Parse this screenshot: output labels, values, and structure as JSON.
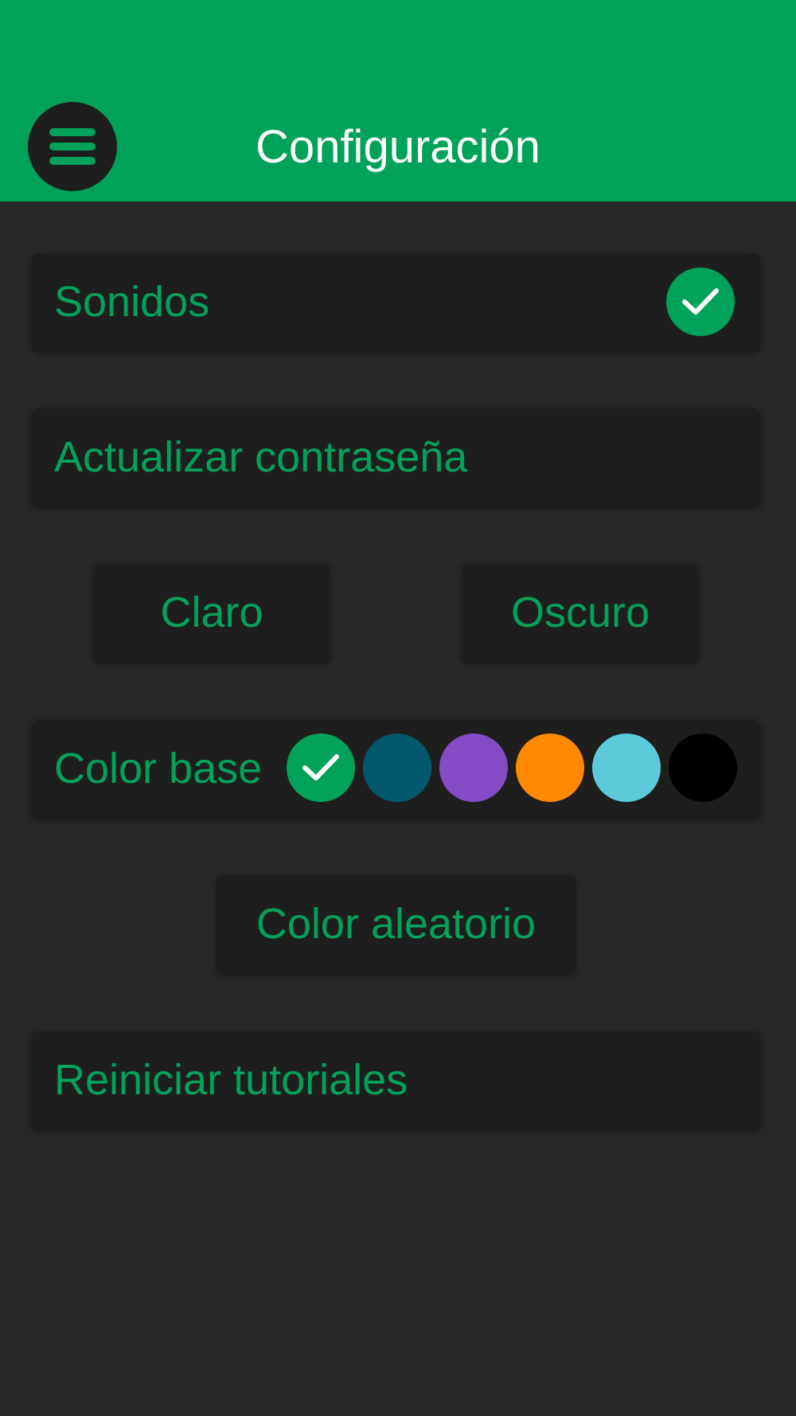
{
  "header": {
    "title": "Configuración",
    "background": "#00a259",
    "menu_icon": "hamburger-menu-icon"
  },
  "settings": {
    "sounds": {
      "label": "Sonidos",
      "checked": true,
      "icon": "checkmark-icon"
    },
    "update_password": {
      "label": "Actualizar contraseña"
    },
    "theme": {
      "light_label": "Claro",
      "dark_label": "Oscuro"
    },
    "base_color": {
      "label": "Color base",
      "swatches": [
        {
          "color": "#00a259",
          "selected": true
        },
        {
          "color": "#01586a",
          "selected": false
        },
        {
          "color": "#834bc4",
          "selected": false
        },
        {
          "color": "#ff8a00",
          "selected": false
        },
        {
          "color": "#5ccadb",
          "selected": false
        },
        {
          "color": "#000000",
          "selected": false
        }
      ]
    },
    "random_color": {
      "label": "Color aleatorio"
    },
    "reset_tutorials": {
      "label": "Reiniciar tutoriales"
    }
  },
  "colors": {
    "accent": "#00a259",
    "background": "#282828",
    "card": "#1e1e1e",
    "text_on_header": "#ffffff"
  }
}
